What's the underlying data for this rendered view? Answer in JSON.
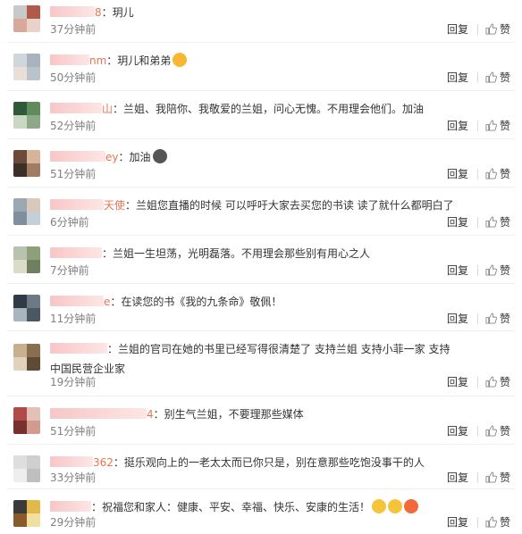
{
  "reply_label": "回复",
  "like_label": "赞",
  "comments": [
    {
      "name_tail": "8",
      "text": "：玥儿",
      "time": "37分钟前"
    },
    {
      "name_tail": "nm",
      "text": "：玥儿和弟弟",
      "time": "50分钟前",
      "emoji": [
        "tongue-out-face"
      ]
    },
    {
      "name_tail": "山",
      "text": "：兰姐、我陪你、我敬爱的兰姐，问心无愧。不用理会他们。加油",
      "time": "52分钟前"
    },
    {
      "name_tail": "ey",
      "text": "：加油",
      "time": "51分钟前",
      "emoji": [
        "flexed-arm"
      ]
    },
    {
      "name_tail": "天使",
      "text": "：兰姐您直播的时候 可以呼吁大家去买您的书读 读了就什么都明白了",
      "time": "6分钟前"
    },
    {
      "name_tail": "",
      "text": "：兰姐一生坦荡，光明磊落。不用理会那些别有用心之人",
      "time": "7分钟前"
    },
    {
      "name_tail": "e",
      "text": "：在读您的书《我的九条命》敬佩！",
      "time": "11分钟前"
    },
    {
      "name_tail": "",
      "text": "：兰姐的官司在她的书里已经写得很清楚了 支持兰姐 支持小菲一家 支持中国民营企业家",
      "time": "19分钟前"
    },
    {
      "name_tail": "4",
      "text": "：别生气兰姐，不要理那些媒体",
      "time": "51分钟前"
    },
    {
      "name_tail": "362",
      "text": "：挺乐观向上的一老太太而已你只是，别在意那些吃饱没事干的人",
      "time": "33分钟前"
    },
    {
      "name_tail": "",
      "text": "：祝福您和家人：健康、平安、幸福、快乐、安康的生活！",
      "time": "29分钟前",
      "emoji": [
        "smile-face",
        "strong-arm",
        "cheer-badge"
      ]
    }
  ]
}
